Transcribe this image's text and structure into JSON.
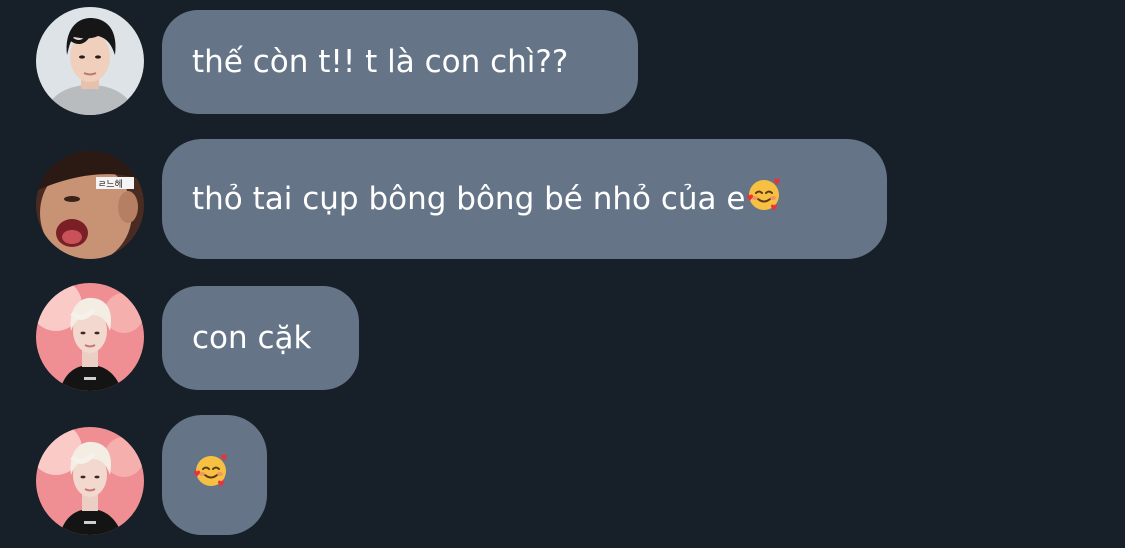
{
  "messages": [
    {
      "sender_avatar": "avatar-dark-hair",
      "text": "thế còn t!! t là con chì??",
      "emoji": ""
    },
    {
      "sender_avatar": "avatar-silly-face",
      "avatar_sticker_text": "ㄹ느헤",
      "text": "thỏ tai cụp bông bông bé nhỏ của e",
      "emoji": "smiling-face-with-hearts-icon"
    },
    {
      "sender_avatar": "avatar-blond-hair",
      "text": "con cặk",
      "emoji": ""
    },
    {
      "sender_avatar": "avatar-blond-hair",
      "text": "",
      "emoji": "smiling-face-with-hearts-icon"
    }
  ],
  "colors": {
    "background": "#171f29",
    "bubble": "#657587",
    "text": "#ffffff"
  }
}
